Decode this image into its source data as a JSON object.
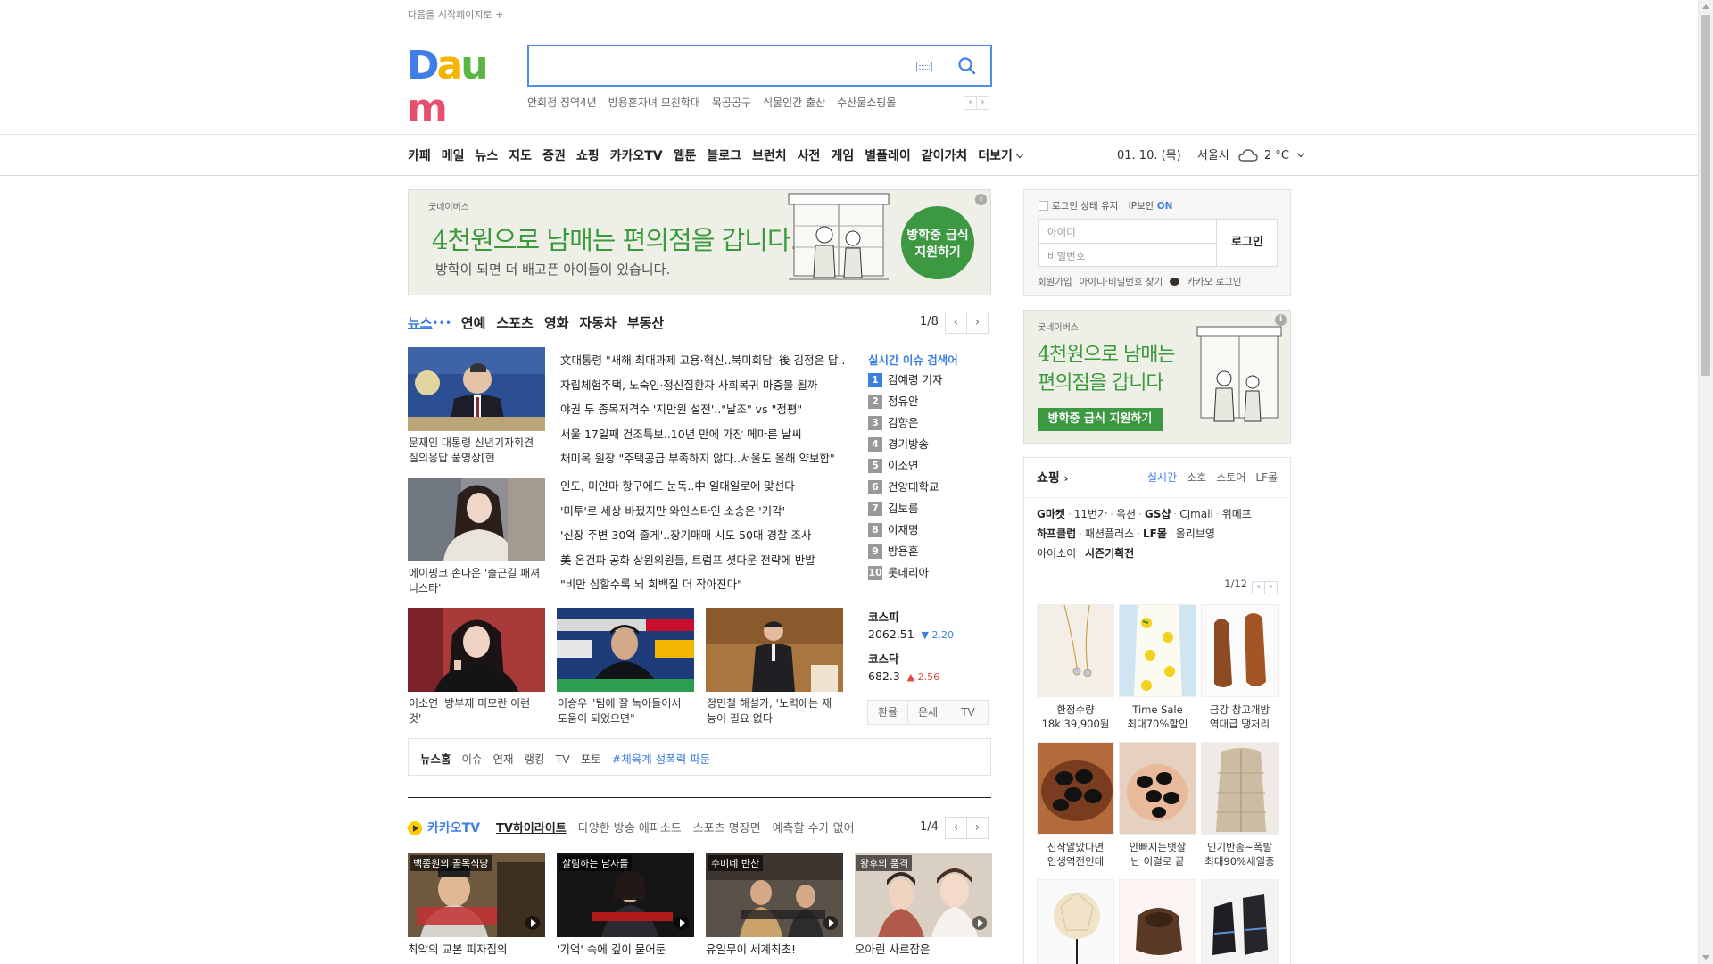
{
  "header": {
    "startpage_label": "다음을 시작페이지로 +",
    "logo_text": "Daum",
    "search_placeholder": "",
    "keywords": [
      "안희정 징역4년",
      "방용훈자녀 모친학대",
      "목공공구",
      "식물인간 출산",
      "수산물쇼핑몰"
    ]
  },
  "nav": {
    "items": [
      "카페",
      "메일",
      "뉴스",
      "지도",
      "증권",
      "쇼핑",
      "카카오TV",
      "웹툰",
      "블로그",
      "브런치",
      "사전",
      "게임",
      "별플레이",
      "같이가치"
    ],
    "more_label": "더보기",
    "date": "01. 10. (목)",
    "city": "서울시",
    "temp": "2 °C"
  },
  "ad_banner": {
    "brand": "굿네이버스",
    "headline": "4천원으로 남매는 편의점을 갑니다.",
    "sub": "방학이 되면 더 배고픈 아이들이 있습니다.",
    "cta_line1": "방학중 급식",
    "cta_line2": "지원하기",
    "info_label": "i"
  },
  "news": {
    "tabs": [
      "뉴스",
      "연예",
      "스포츠",
      "영화",
      "자동차",
      "부동산"
    ],
    "dots": "•••",
    "page": "1/8",
    "thumb_captions": [
      "문재인 대통령 신년기자회견 질의응답 풀영상[현",
      "에이핑크 손나은 '출근길 패셔니스타'",
      "이소연 '방부제 미모란 이런것'",
      "이승우 \"팀에 잘 녹아들어서 도움이 되었으면\"",
      "정민철 해설가, '노력에는 재능이 필요 없다'"
    ],
    "headlines_a": [
      "文대통령 \"새해 최대과제 고용·혁신..북미회담' 後 김정은 답..",
      "자립체험주택, 노숙인·정신질환자 사회복귀 마중물 될까",
      "야권 두 종목저격수 '지만원 설전'..\"날조\" vs \"정평\"",
      "서울 17일째 건조특보..10년 만에 가장 메마른 날씨",
      "채미옥 원장 \"주택공급 부족하지 않다..서울도 올해 약보합\""
    ],
    "headlines_b": [
      "인도, 미얀마 항구에도 눈독..中 일대일로에 맞선다",
      "'미투'로 세상 바꿨지만 와인스타인 소송은 '기각'",
      "'신장 주변 30억 줄게'..장기매매 시도 50대 경찰 조사",
      "美 온건파 공화 상원의원들, 트럼프 셧다운 전략에 반발",
      "\"비만 심할수록 뇌 회백질 더 작아진다\""
    ]
  },
  "realtime": {
    "title": "실시간 이슈 검색어",
    "items": [
      "김예령 기자",
      "정유안",
      "김향은",
      "경기방송",
      "이소연",
      "건양대학교",
      "김보름",
      "이재명",
      "방용훈",
      "롯데리아"
    ]
  },
  "stocks": {
    "kospi_label": "코스피",
    "kospi_value": "2062.51",
    "kospi_change": "▼ 2.20",
    "kosdaq_label": "코스닥",
    "kosdaq_value": "682.3",
    "kosdaq_change": "▲ 2.56",
    "buttons": [
      "환율",
      "운세",
      "TV"
    ]
  },
  "newshome": {
    "label": "뉴스홈",
    "links": [
      "이슈",
      "연재",
      "랭킹",
      "TV",
      "포토"
    ],
    "hot": "#체육계 성폭력 파문"
  },
  "kakaotv": {
    "name": "카카오TV",
    "tabs": [
      "TV하이라이트",
      "다양한 방송 에피소드",
      "스포츠 명장면",
      "예측할 수가 없어"
    ],
    "page": "1/4",
    "videos": [
      {
        "label": "백종원의 골목식당",
        "caption": "최악의 교본 피자집의"
      },
      {
        "label": "살림하는 남자들",
        "caption": "'기억' 속에 깊이 묻어둔"
      },
      {
        "label": "수미네 반찬",
        "caption": "유일무이 세계최초!"
      },
      {
        "label": "왕후의 품격",
        "caption": "오아린 사르잡은"
      }
    ]
  },
  "login": {
    "keep_label": "로그인 상태 유지",
    "ip_label": "IP보안",
    "ip_state": "ON",
    "id_placeholder": "아이디",
    "pw_placeholder": "비밀번호",
    "button": "로그인",
    "links": [
      "회원가입",
      "아이디·비밀번호 찾기",
      "카카오 로그인"
    ]
  },
  "ad_banner2": {
    "brand": "굿네이버스",
    "line1": "4천원으로 남매는",
    "line2": "편의점을 갑니다",
    "cta": "방학중 급식 지원하기"
  },
  "shopping": {
    "title": "쇼핑",
    "tabs": [
      "실시간",
      "소호",
      "스토어",
      "LF몰"
    ],
    "malls_row1": [
      "G마켓",
      "11번가",
      "옥션",
      "GS샵",
      "CJmall",
      "위메프"
    ],
    "malls_row2": [
      "하프클럽",
      "패션플러스",
      "LF몰",
      "올리브영"
    ],
    "malls_row3": [
      "아이소이",
      "시즌기획전"
    ],
    "page": "1/12",
    "products": [
      {
        "l1": "한정수량",
        "l2": "18k 39,900원"
      },
      {
        "l1": "Time Sale",
        "l2": "최대70%할인"
      },
      {
        "l1": "금강 창고개방",
        "l2": "역대급 땡처리"
      },
      {
        "l1": "진작알았다면",
        "l2": "인생역전인데"
      },
      {
        "l1": "안빠지는뱃살",
        "l2": "난 이걸로 끝"
      },
      {
        "l1": "인기반종~폭발",
        "l2": "최대90%세일중"
      }
    ]
  }
}
